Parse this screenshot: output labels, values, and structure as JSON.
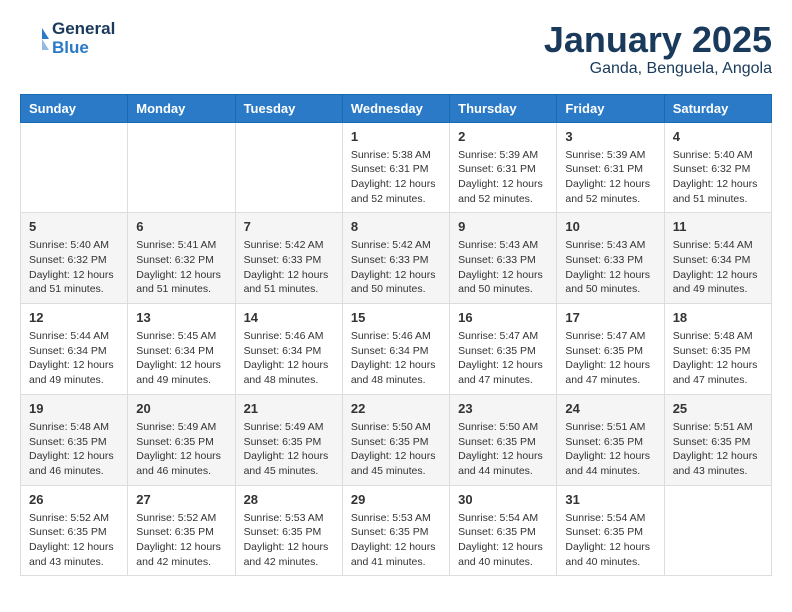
{
  "header": {
    "logo_text_general": "General",
    "logo_text_blue": "Blue",
    "month_year": "January 2025",
    "location": "Ganda, Benguela, Angola"
  },
  "days_of_week": [
    "Sunday",
    "Monday",
    "Tuesday",
    "Wednesday",
    "Thursday",
    "Friday",
    "Saturday"
  ],
  "weeks": [
    [
      {
        "day": "",
        "info": ""
      },
      {
        "day": "",
        "info": ""
      },
      {
        "day": "",
        "info": ""
      },
      {
        "day": "1",
        "info": "Sunrise: 5:38 AM\nSunset: 6:31 PM\nDaylight: 12 hours\nand 52 minutes."
      },
      {
        "day": "2",
        "info": "Sunrise: 5:39 AM\nSunset: 6:31 PM\nDaylight: 12 hours\nand 52 minutes."
      },
      {
        "day": "3",
        "info": "Sunrise: 5:39 AM\nSunset: 6:31 PM\nDaylight: 12 hours\nand 52 minutes."
      },
      {
        "day": "4",
        "info": "Sunrise: 5:40 AM\nSunset: 6:32 PM\nDaylight: 12 hours\nand 51 minutes."
      }
    ],
    [
      {
        "day": "5",
        "info": "Sunrise: 5:40 AM\nSunset: 6:32 PM\nDaylight: 12 hours\nand 51 minutes."
      },
      {
        "day": "6",
        "info": "Sunrise: 5:41 AM\nSunset: 6:32 PM\nDaylight: 12 hours\nand 51 minutes."
      },
      {
        "day": "7",
        "info": "Sunrise: 5:42 AM\nSunset: 6:33 PM\nDaylight: 12 hours\nand 51 minutes."
      },
      {
        "day": "8",
        "info": "Sunrise: 5:42 AM\nSunset: 6:33 PM\nDaylight: 12 hours\nand 50 minutes."
      },
      {
        "day": "9",
        "info": "Sunrise: 5:43 AM\nSunset: 6:33 PM\nDaylight: 12 hours\nand 50 minutes."
      },
      {
        "day": "10",
        "info": "Sunrise: 5:43 AM\nSunset: 6:33 PM\nDaylight: 12 hours\nand 50 minutes."
      },
      {
        "day": "11",
        "info": "Sunrise: 5:44 AM\nSunset: 6:34 PM\nDaylight: 12 hours\nand 49 minutes."
      }
    ],
    [
      {
        "day": "12",
        "info": "Sunrise: 5:44 AM\nSunset: 6:34 PM\nDaylight: 12 hours\nand 49 minutes."
      },
      {
        "day": "13",
        "info": "Sunrise: 5:45 AM\nSunset: 6:34 PM\nDaylight: 12 hours\nand 49 minutes."
      },
      {
        "day": "14",
        "info": "Sunrise: 5:46 AM\nSunset: 6:34 PM\nDaylight: 12 hours\nand 48 minutes."
      },
      {
        "day": "15",
        "info": "Sunrise: 5:46 AM\nSunset: 6:34 PM\nDaylight: 12 hours\nand 48 minutes."
      },
      {
        "day": "16",
        "info": "Sunrise: 5:47 AM\nSunset: 6:35 PM\nDaylight: 12 hours\nand 47 minutes."
      },
      {
        "day": "17",
        "info": "Sunrise: 5:47 AM\nSunset: 6:35 PM\nDaylight: 12 hours\nand 47 minutes."
      },
      {
        "day": "18",
        "info": "Sunrise: 5:48 AM\nSunset: 6:35 PM\nDaylight: 12 hours\nand 47 minutes."
      }
    ],
    [
      {
        "day": "19",
        "info": "Sunrise: 5:48 AM\nSunset: 6:35 PM\nDaylight: 12 hours\nand 46 minutes."
      },
      {
        "day": "20",
        "info": "Sunrise: 5:49 AM\nSunset: 6:35 PM\nDaylight: 12 hours\nand 46 minutes."
      },
      {
        "day": "21",
        "info": "Sunrise: 5:49 AM\nSunset: 6:35 PM\nDaylight: 12 hours\nand 45 minutes."
      },
      {
        "day": "22",
        "info": "Sunrise: 5:50 AM\nSunset: 6:35 PM\nDaylight: 12 hours\nand 45 minutes."
      },
      {
        "day": "23",
        "info": "Sunrise: 5:50 AM\nSunset: 6:35 PM\nDaylight: 12 hours\nand 44 minutes."
      },
      {
        "day": "24",
        "info": "Sunrise: 5:51 AM\nSunset: 6:35 PM\nDaylight: 12 hours\nand 44 minutes."
      },
      {
        "day": "25",
        "info": "Sunrise: 5:51 AM\nSunset: 6:35 PM\nDaylight: 12 hours\nand 43 minutes."
      }
    ],
    [
      {
        "day": "26",
        "info": "Sunrise: 5:52 AM\nSunset: 6:35 PM\nDaylight: 12 hours\nand 43 minutes."
      },
      {
        "day": "27",
        "info": "Sunrise: 5:52 AM\nSunset: 6:35 PM\nDaylight: 12 hours\nand 42 minutes."
      },
      {
        "day": "28",
        "info": "Sunrise: 5:53 AM\nSunset: 6:35 PM\nDaylight: 12 hours\nand 42 minutes."
      },
      {
        "day": "29",
        "info": "Sunrise: 5:53 AM\nSunset: 6:35 PM\nDaylight: 12 hours\nand 41 minutes."
      },
      {
        "day": "30",
        "info": "Sunrise: 5:54 AM\nSunset: 6:35 PM\nDaylight: 12 hours\nand 40 minutes."
      },
      {
        "day": "31",
        "info": "Sunrise: 5:54 AM\nSunset: 6:35 PM\nDaylight: 12 hours\nand 40 minutes."
      },
      {
        "day": "",
        "info": ""
      }
    ]
  ]
}
